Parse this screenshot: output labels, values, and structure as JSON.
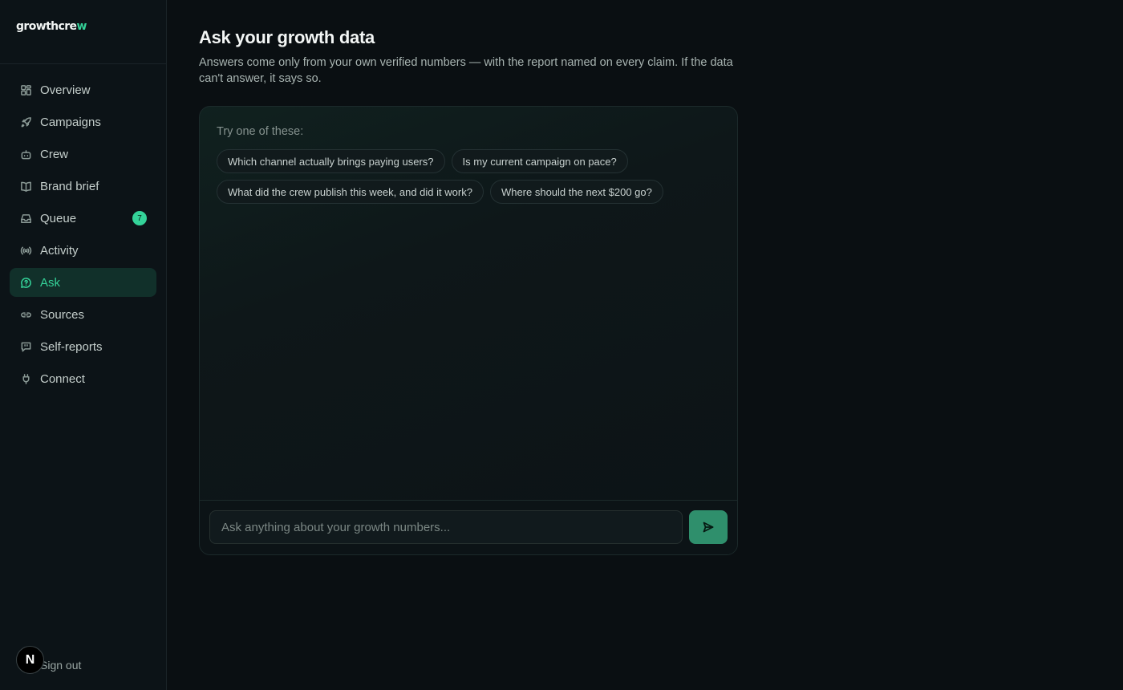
{
  "brand": {
    "name_main": "growthcre",
    "name_accent": "w",
    "accent_color": "#34d399"
  },
  "sidebar": {
    "items": [
      {
        "label": "Overview",
        "icon": "grid-icon"
      },
      {
        "label": "Campaigns",
        "icon": "rocket-icon"
      },
      {
        "label": "Crew",
        "icon": "bot-icon"
      },
      {
        "label": "Brand brief",
        "icon": "book-icon"
      },
      {
        "label": "Queue",
        "icon": "inbox-icon",
        "badge": "7"
      },
      {
        "label": "Activity",
        "icon": "broadcast-icon"
      },
      {
        "label": "Ask",
        "icon": "question-bubble-icon",
        "active": true
      },
      {
        "label": "Sources",
        "icon": "link-icon"
      },
      {
        "label": "Self-reports",
        "icon": "quote-icon"
      },
      {
        "label": "Connect",
        "icon": "plug-icon"
      }
    ],
    "signout_label": "Sign out",
    "avatar_initial": "N"
  },
  "main": {
    "title": "Ask your growth data",
    "subtitle": "Answers come only from your own verified numbers — with the report named on every claim. If the data can't answer, it says so.",
    "try_label": "Try one of these:",
    "suggestions": [
      "Which channel actually brings paying users?",
      "Is my current campaign on pace?",
      "What did the crew publish this week, and did it work?",
      "Where should the next $200 go?"
    ],
    "input_placeholder": "Ask anything about your growth numbers...",
    "send_icon": "send-icon"
  }
}
